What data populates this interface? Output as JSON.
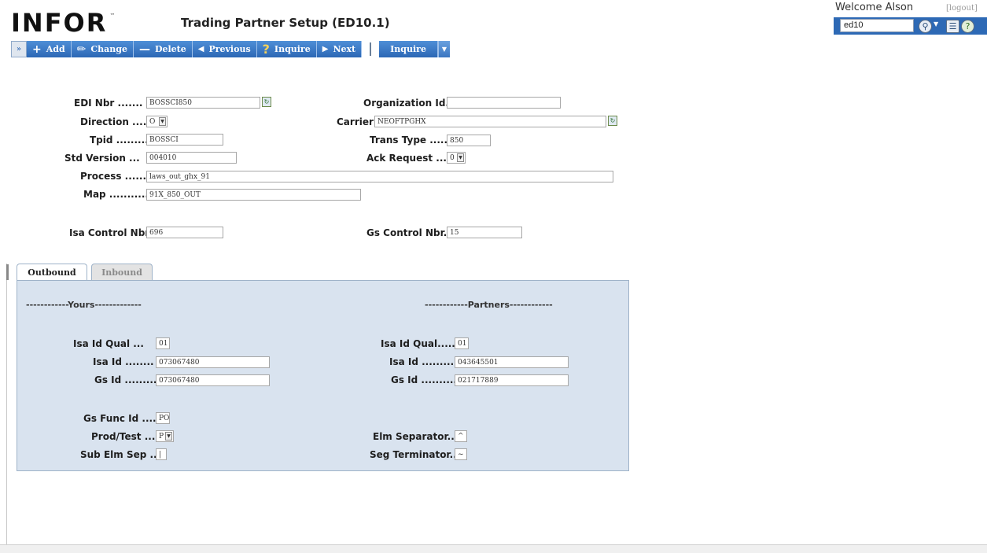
{
  "header": {
    "logo_text": "INFOR",
    "logo_tm": "™",
    "title": "Trading Partner Setup (ED10.1)",
    "welcome": "Welcome Alson",
    "logout": "[logout]",
    "search_value": "ed10"
  },
  "toolbar": {
    "add": "Add",
    "change": "Change",
    "delete": "Delete",
    "previous": "Previous",
    "inquire": "Inquire",
    "next": "Next",
    "inquire_menu": "Inquire"
  },
  "form": {
    "edi_nbr_label": "EDI Nbr .......",
    "edi_nbr": "BOSSCI850",
    "org_id_label": "Organization Id.",
    "org_id": "",
    "direction_label": "Direction .....",
    "direction": "O",
    "carrier_label": "Carrier",
    "carrier": "NEOFTPGHX",
    "tpid_label": "Tpid ..........",
    "tpid": "BOSSCI",
    "trans_type_label": "Trans Type .....",
    "trans_type": "850",
    "std_version_label": "Std Version ...",
    "std_version": "004010",
    "ack_request_label": "Ack Request ....",
    "ack_request": "0",
    "process_label": "Process .......",
    "process": "laws_out_ghx_91",
    "map_label": "Map ...........",
    "map": "91X_850_OUT",
    "isa_control_label": "Isa Control Nbr",
    "isa_control": "696",
    "gs_control_label": "Gs Control Nbr..",
    "gs_control": "15"
  },
  "tabs": {
    "outbound": "Outbound",
    "inbound": "Inbound"
  },
  "outbound": {
    "yours_head": "------------Yours-------------",
    "partners_head": "------------Partners------------",
    "y_isa_qual_label": "Isa Id Qual ...",
    "y_isa_qual": "01",
    "y_isa_id_label": "Isa Id ........",
    "y_isa_id": "073067480",
    "y_gs_id_label": "Gs Id .........",
    "y_gs_id": "073067480",
    "p_isa_qual_label": "Isa Id Qual.....",
    "p_isa_qual": "01",
    "p_isa_id_label": "Isa Id .........",
    "p_isa_id": "043645501",
    "p_gs_id_label": "Gs Id ..........",
    "p_gs_id": "021717889",
    "gs_func_label": "Gs Func Id ....",
    "gs_func": "PO",
    "prod_test_label": "Prod/Test .....",
    "prod_test": "P",
    "sub_elm_label": "Sub Elm Sep ...",
    "sub_elm": "|",
    "elm_sep_label": "Elm Separator...",
    "elm_sep": "^",
    "seg_term_label": "Seg Terminator..",
    "seg_term": "~"
  },
  "colors": {
    "toolbar_blue": "#2c67b5",
    "panel_bg": "#d9e3ef"
  }
}
